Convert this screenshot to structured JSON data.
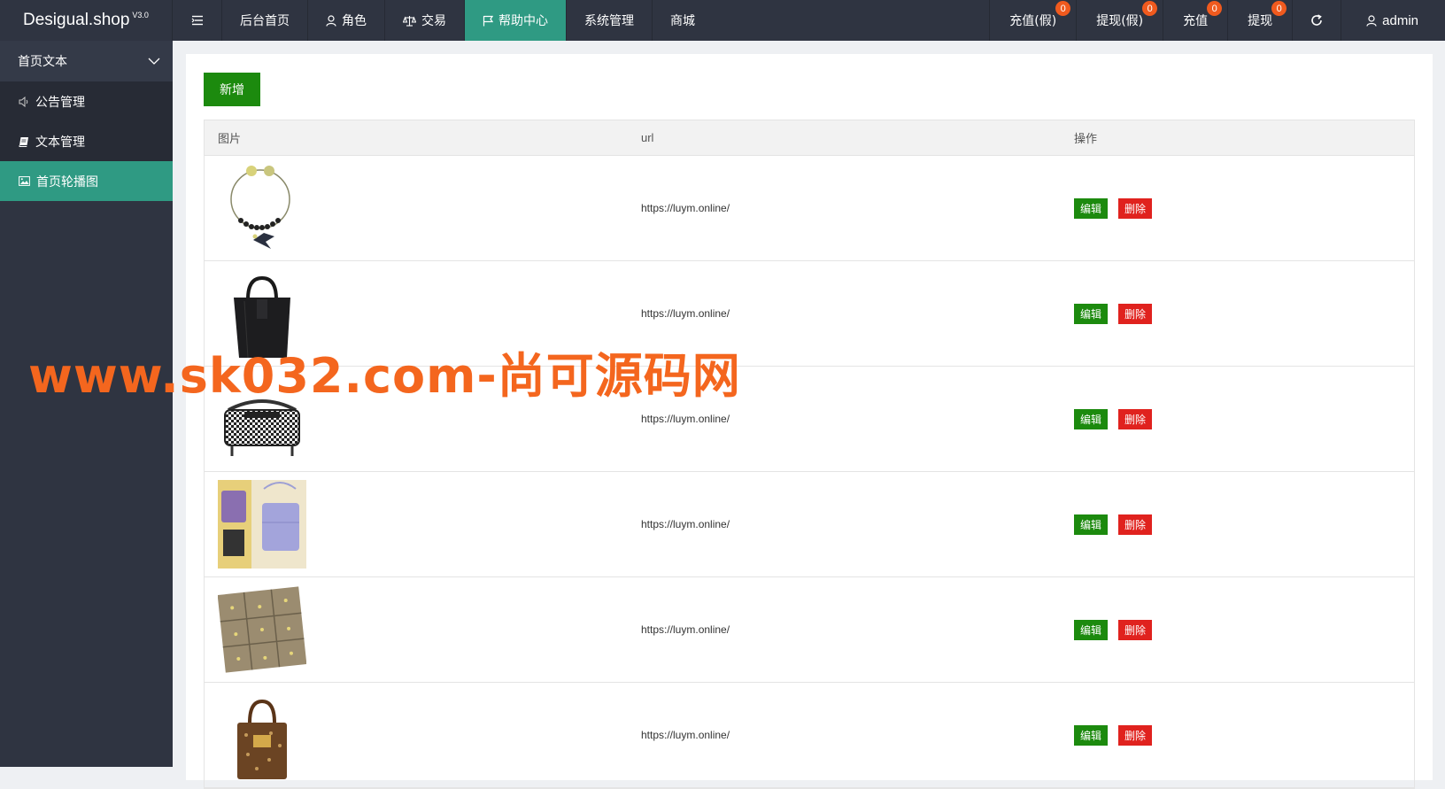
{
  "header": {
    "logo": "Desigual.shop",
    "version": "V3.0",
    "nav": [
      {
        "label": "后台首页",
        "icon": ""
      },
      {
        "label": "角色",
        "icon": "user-icon"
      },
      {
        "label": "交易",
        "icon": "scale-icon"
      },
      {
        "label": "帮助中心",
        "icon": "flag-icon",
        "active": true
      },
      {
        "label": "系统管理",
        "icon": ""
      },
      {
        "label": "商城",
        "icon": ""
      }
    ],
    "right": [
      {
        "label": "充值(假)",
        "badge": "0"
      },
      {
        "label": "提现(假)",
        "badge": "0"
      },
      {
        "label": "充值",
        "badge": "0"
      },
      {
        "label": "提现",
        "badge": "0"
      }
    ],
    "user": "admin"
  },
  "sidebar": {
    "group": "首页文本",
    "items": [
      {
        "label": "公告管理",
        "icon": "speaker-icon"
      },
      {
        "label": "文本管理",
        "icon": "book-icon"
      },
      {
        "label": "首页轮播图",
        "icon": "image-icon",
        "active": true
      }
    ]
  },
  "main": {
    "add_label": "新增",
    "columns": [
      "图片",
      "url",
      "操作"
    ],
    "edit_label": "编辑",
    "delete_label": "删除",
    "rows": [
      {
        "url": "https://luym.online/",
        "image": "necklace"
      },
      {
        "url": "https://luym.online/",
        "image": "black-bag"
      },
      {
        "url": "https://luym.online/",
        "image": "houndstooth-bag"
      },
      {
        "url": "https://luym.online/",
        "image": "phone-bag"
      },
      {
        "url": "https://luym.online/",
        "image": "jewelry-grid"
      },
      {
        "url": "https://luym.online/",
        "image": "monogram-bag"
      }
    ]
  },
  "watermark": "www.sk032.com-尚可源码网",
  "colors": {
    "accent": "#2f9a83",
    "dark": "#2f3441",
    "green": "#1c8a0e",
    "red": "#e0221e",
    "badge": "#f05a1e"
  }
}
